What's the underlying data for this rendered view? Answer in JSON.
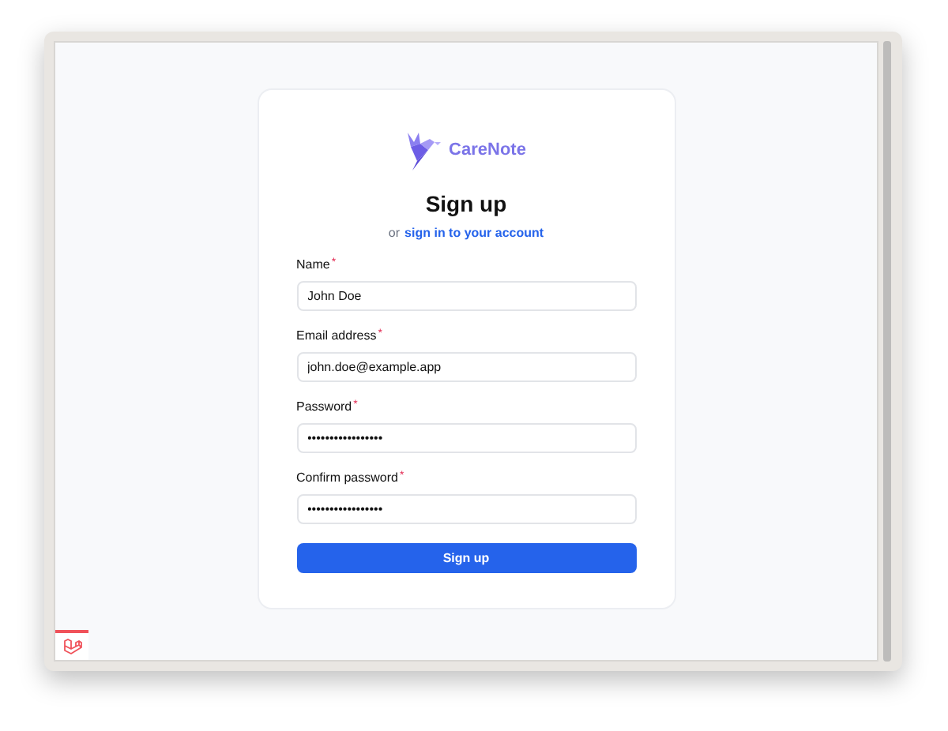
{
  "brand": {
    "name": "CareNote"
  },
  "title": "Sign up",
  "subtitle": {
    "prefix": "or",
    "link": "sign in to your account"
  },
  "fields": [
    {
      "label": "Name",
      "required_mark": "*",
      "value": "John Doe"
    },
    {
      "label": "Email address",
      "required_mark": "*",
      "value": "john.doe@example.app"
    },
    {
      "label": "Password",
      "required_mark": "*",
      "value": "•••••••••••••••••"
    },
    {
      "label": "Confirm password",
      "required_mark": "*",
      "value": "•••••••••••••••••"
    }
  ],
  "submit": "Sign up"
}
